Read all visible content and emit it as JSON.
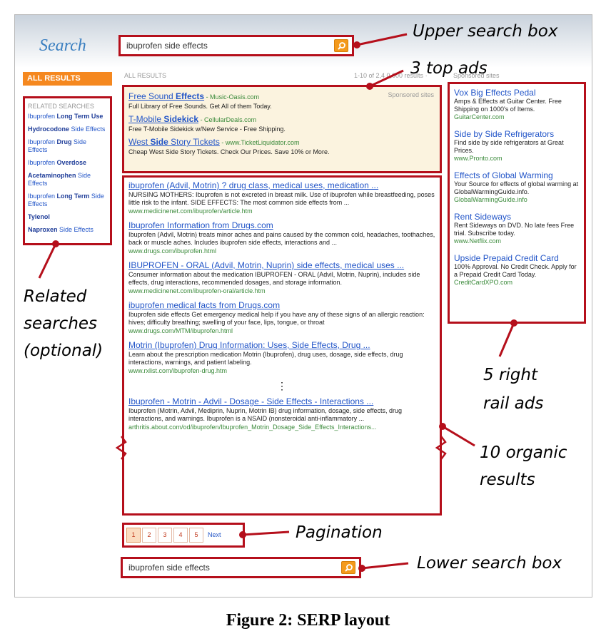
{
  "brand": "Search",
  "query": "ibuprofen side effects",
  "tabs": {
    "all_results": "ALL RESULTS"
  },
  "results_header": {
    "label": "ALL RESULTS",
    "count": "1-10 of 2,4 0,000 results ·"
  },
  "sponsored_header": "Sponsored sites",
  "related": {
    "header": "RELATED SEARCHES",
    "items": [
      {
        "pre": "Ibuprofen ",
        "bold": "Long Term Use",
        "post": ""
      },
      {
        "pre": "",
        "bold": "Hydrocodone",
        "post": " Side Effects"
      },
      {
        "pre": "Ibuprofen ",
        "bold": "Drug",
        "post": " Side Effects"
      },
      {
        "pre": "Ibuprofen ",
        "bold": "Overdose",
        "post": ""
      },
      {
        "pre": "",
        "bold": "Acetaminophen",
        "post": " Side Effects"
      },
      {
        "pre": "Ibuprofen ",
        "bold": "Long Term",
        "post": " Side Effects"
      },
      {
        "pre": "",
        "bold": "Tylenol",
        "post": ""
      },
      {
        "pre": "",
        "bold": "Naproxen",
        "post": " Side Effects"
      }
    ]
  },
  "top_ads": {
    "sponsored_label": "Sponsored sites",
    "items": [
      {
        "title_pre": "Free Sound ",
        "title_bold": "Effects",
        "title_post": "",
        "url": " - Music-Oasis.com",
        "desc": "Full Library of Free Sounds. Get All of them Today."
      },
      {
        "title_pre": "T-Mobile ",
        "title_bold": "Sidekick",
        "title_post": "",
        "url": " - CellularDeals.com",
        "desc": "Free T-Mobile Sidekick w/New Service - Free Shipping."
      },
      {
        "title_pre": "West ",
        "title_bold": "Side",
        "title_post": " Story Tickets",
        "url": " - www.TicketLiquidator.com",
        "desc": "Cheap West Side Story Tickets. Check Our Prices. Save 10% or More."
      }
    ]
  },
  "organic": {
    "items": [
      {
        "title": "ibuprofen (Advil, Motrin) ? drug class, medical uses, medication ...",
        "snippet": "NURSING MOTHERS: Ibuprofen is not excreted in breast milk. Use of ibuprofen while breastfeeding, poses little risk to the infant. SIDE EFFECTS: The most common side effects from ...",
        "url": "www.medicinenet.com/ibuprofen/article.htm"
      },
      {
        "title": "Ibuprofen Information from Drugs.com",
        "snippet": "Ibuprofen (Advil, Motrin) treats minor aches and pains caused by the common cold, headaches, toothaches, back or muscle aches. Includes ibuprofen side effects, interactions and ...",
        "url": "www.drugs.com/ibuprofen.html"
      },
      {
        "title": "IBUPROFEN - ORAL (Advil, Motrin, Nuprin) side effects, medical uses ...",
        "snippet": "Consumer information about the medication IBUPROFEN - ORAL (Advil, Motrin, Nuprin), includes side effects, drug interactions, recommended dosages, and storage information.",
        "url": "www.medicinenet.com/ibuprofen-oral/article.htm"
      },
      {
        "title": "ibuprofen medical facts from Drugs.com",
        "snippet": "Ibuprofen side effects Get emergency medical help if you have any of these signs of an allergic reaction: hives; difficulty breathing; swelling of your face, lips, tongue, or throat",
        "url": "www.drugs.com/MTM/ibuprofen.html"
      },
      {
        "title": "Motrin (Ibuprofen) Drug Information: Uses, Side Effects, Drug ...",
        "snippet": "Learn about the prescription medication Motrin (Ibuprofen), drug uses, dosage, side effects, drug interactions, warnings, and patient labeling.",
        "url": "www.rxlist.com/ibuprofen-drug.htm"
      },
      {
        "title": "Ibuprofen - Motrin - Advil - Dosage - Side Effects - Interactions ...",
        "snippet": "Ibuprofen (Motrin, Advil, Mediprin, Nuprin, Motrin IB) drug information, dosage, side effects, drug interactions, and warnings. Ibuprofen is a NSAID (nonsteroidal anti-inflammatory ...",
        "url": "arthritis.about.com/od/ibuprofen/Ibuprofen_Motrin_Dosage_Side_Effects_Interactions..."
      }
    ],
    "ellipsis": "⋮"
  },
  "rail_ads": {
    "items": [
      {
        "title": "Vox Big Effects Pedal",
        "desc": "Amps & Effects at Guitar Center. Free Shipping on 1000's of Items.",
        "url": "GuitarCenter.com"
      },
      {
        "title": "Side by Side Refrigerators",
        "desc": "Find side by side refrigerators at Great Prices.",
        "url": "www.Pronto.com"
      },
      {
        "title": "Effects of Global Warming",
        "desc": "Your Source for effects of global warming at GlobalWarmingGuide.info.",
        "url": "GlobalWarmingGuide.info"
      },
      {
        "title": "Rent Sideways",
        "desc": "Rent Sideways on DVD. No late fees Free trial. Subscribe today.",
        "url": "www.Netflix.com"
      },
      {
        "title": "Upside Prepaid Credit Card",
        "desc": "100% Approval. No Credit Check. Apply for a Prepaid Credit Card Today.",
        "url": "CreditCardXPO.com"
      }
    ]
  },
  "pagination": {
    "pages": [
      "1",
      "2",
      "3",
      "4",
      "5"
    ],
    "current": "1",
    "next": "Next"
  },
  "annotations": {
    "upper_search": "Upper search box",
    "top_ads": "3 top ads",
    "related_1": "Related",
    "related_2": "searches",
    "related_3": "(optional)",
    "right_rail_1": "5 right",
    "right_rail_2": "rail ads",
    "organic_1": "10 organic",
    "organic_2": "results",
    "pagination": "Pagination",
    "lower_search": "Lower search box"
  },
  "caption": "Figure 2: SERP layout",
  "colors": {
    "highlight_red": "#b50f1b",
    "link_blue": "#2255c8",
    "url_green": "#3a8a3a",
    "tab_orange": "#f5881f"
  }
}
